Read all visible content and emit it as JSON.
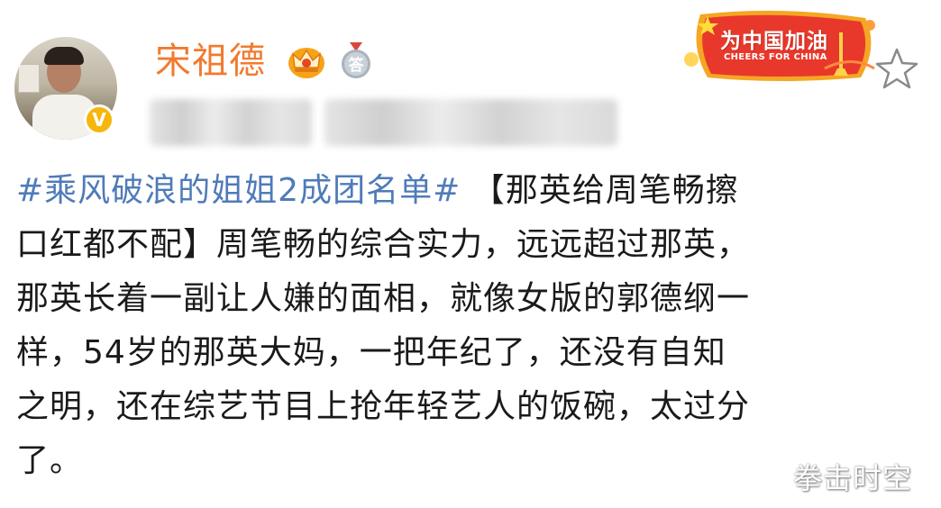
{
  "user": {
    "name": "宋祖德",
    "verified_badge": "V"
  },
  "icons": {
    "crown": "crown-icon",
    "medal": "medal-answer-icon",
    "star": "star-icon"
  },
  "badge_text": "答",
  "banner": {
    "title": "为中国加油",
    "subtitle": "CHEERS FOR CHINA"
  },
  "post": {
    "line1_hashtag": "#乘风破浪的姐姐2成团名单#",
    "line1_rest": "【那英给周笔畅擦",
    "line2": "口红都不配】周笔畅的综合实力，远远超过那英，",
    "line3": "那英长着一副让人嫌的面相，就像女版的郭德纲一",
    "line4": "样，54岁的那英大妈，一把年纪了，还没有自知",
    "line5": "之明，还在综艺节目上抢年轻艺人的饭碗，太过分",
    "line6": "了。"
  },
  "watermark": "拳击时空",
  "colors": {
    "username": "#f27a2d",
    "hashtag": "#4f7bb8",
    "verified": "#f6b60b",
    "banner_red": "#e8382b"
  }
}
